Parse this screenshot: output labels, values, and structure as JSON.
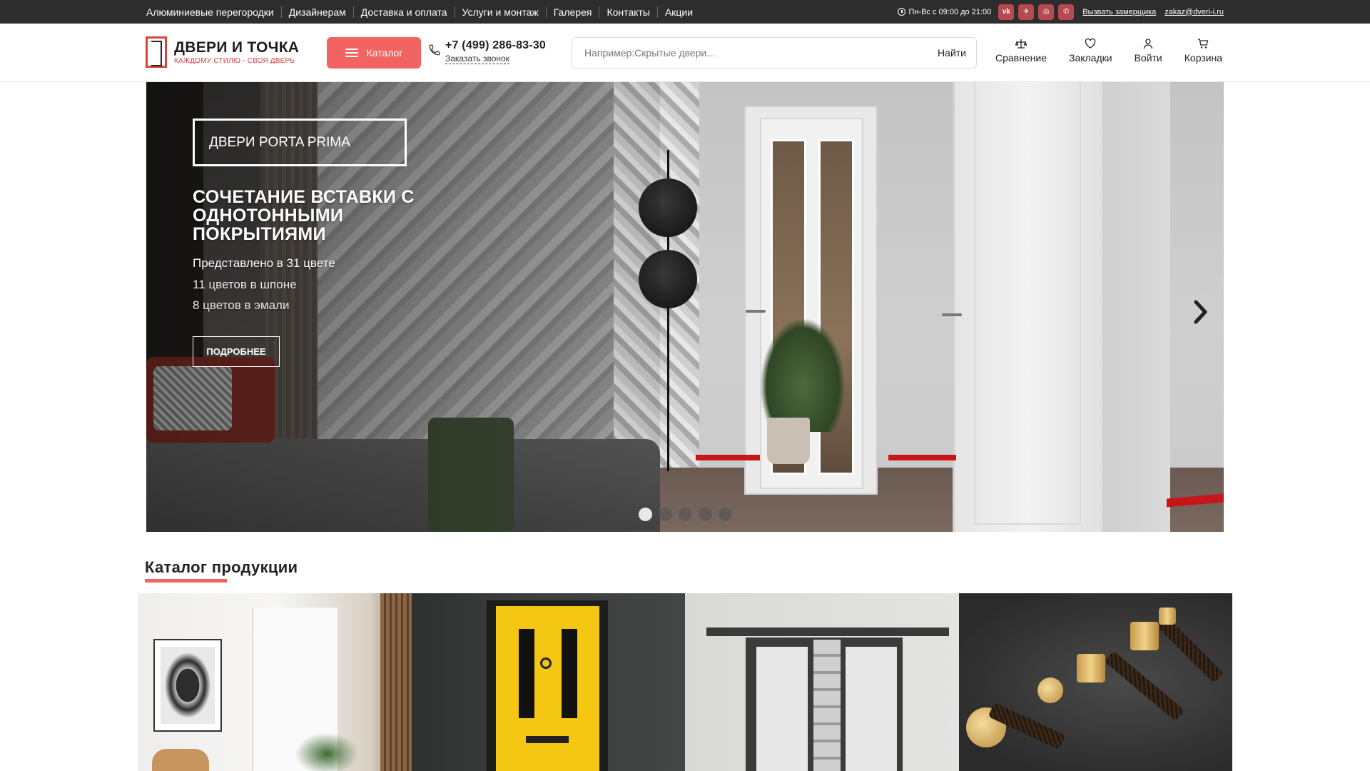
{
  "topbar": {
    "nav": [
      "Алюминиевые перегородки",
      "Дизайнерам",
      "Доставка и оплата",
      "Услуги и монтаж",
      "Галерея",
      "Контакты",
      "Акции"
    ],
    "hours": "Пн-Вс с 09:00 до 21:00",
    "social": [
      {
        "name": "vk-icon",
        "glyph": "vk",
        "color": "#b54a50"
      },
      {
        "name": "telegram-icon",
        "glyph": "✈",
        "color": "#b54a50"
      },
      {
        "name": "instagram-icon",
        "glyph": "◎",
        "color": "#b54a50"
      },
      {
        "name": "whatsapp-icon",
        "glyph": "✆",
        "color": "#b54a50"
      }
    ],
    "measure_link": "Вызвать замерщика",
    "email": "zakaz@dveri-i.ru"
  },
  "header": {
    "logo_title": "ДВЕРИ И ТОЧКА",
    "logo_sub": "КАЖДОМУ СТИЛЮ - СВОЯ ДВЕРЬ",
    "catalog_label": "Каталог",
    "phone": "+7 (499) 286-83-30",
    "callback": "Заказать звонок",
    "search_placeholder": "Например:Скрытые двери...",
    "search_button": "Найти",
    "icons": [
      {
        "label": "Сравнение",
        "icon": "compare-icon"
      },
      {
        "label": "Закладки",
        "icon": "heart-icon"
      },
      {
        "label": "Войти",
        "icon": "user-icon"
      },
      {
        "label": "Корзина",
        "icon": "cart-icon"
      }
    ]
  },
  "hero": {
    "badge": "ДВЕРИ PORTA PRIMA",
    "title": "СОЧЕТАНИЕ ВСТАВКИ С ОДНОТОННЫМИ ПОКРЫТИЯМИ",
    "sub1": "Представлено в 31 цвете",
    "sub2": "11 цветов в шпоне",
    "sub3": "8 цветов в эмали",
    "more_label": "ПОДРОБНЕЕ",
    "slides_count": 5,
    "active_slide": 1
  },
  "catalog": {
    "title": "Каталог продукции"
  },
  "colors": {
    "accent": "#f26461",
    "topbar_bg": "#2d2d2d",
    "social_bg": "#b54a50"
  }
}
